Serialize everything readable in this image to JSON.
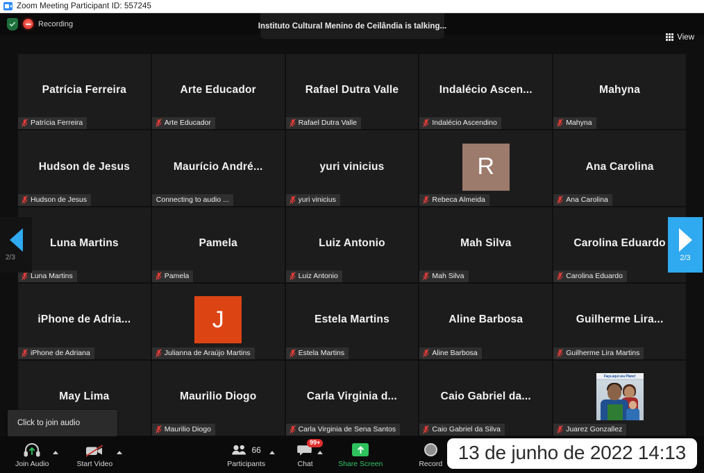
{
  "titlebar": {
    "icon": "zoom-app-icon",
    "title": "Zoom Meeting Participant ID: 557245"
  },
  "topbar": {
    "shield_icon": "encryption-shield-icon",
    "recording_icon": "recording-indicator-icon",
    "recording_label": "Recording",
    "talking_status": "Instituto Cultural Menino de Ceilândia is talking...",
    "view_icon": "grid-view-icon",
    "view_label": "View"
  },
  "gallery": {
    "page_indicator": "2/3",
    "prev_icon": "chevron-left-icon",
    "next_icon": "chevron-right-icon",
    "mic_icon": "microphone-muted-icon",
    "tiles": [
      {
        "display_name": "Patrícia Ferreira",
        "footer": "Patrícia Ferreira",
        "muted": true,
        "avatar": null
      },
      {
        "display_name": "Arte Educador",
        "footer": "Arte Educador",
        "muted": true,
        "avatar": null
      },
      {
        "display_name": "Rafael Dutra Valle",
        "footer": "Rafael Dutra Valle",
        "muted": true,
        "avatar": null
      },
      {
        "display_name": "Indalécio  Ascen...",
        "footer": "Indalécio Ascendino",
        "muted": true,
        "avatar": null
      },
      {
        "display_name": "Mahyna",
        "footer": "Mahyna",
        "muted": true,
        "avatar": null
      },
      {
        "display_name": "Hudson de Jesus",
        "footer": "Hudson de Jesus",
        "muted": true,
        "avatar": null
      },
      {
        "display_name": "Maurício  André...",
        "footer": "Connecting to audio ...",
        "muted": false,
        "avatar": null
      },
      {
        "display_name": "yuri vinicius",
        "footer": "yuri vinicius",
        "muted": true,
        "avatar": null
      },
      {
        "display_name": "",
        "footer": "Rebeca Almeida",
        "muted": true,
        "avatar": {
          "type": "initial",
          "letter": "R",
          "color": "#9c7a6c"
        }
      },
      {
        "display_name": "Ana Carolina",
        "footer": "Ana Carolina",
        "muted": true,
        "avatar": null
      },
      {
        "display_name": "Luna Martins",
        "footer": "Luna Martins",
        "muted": true,
        "avatar": null
      },
      {
        "display_name": "Pamela",
        "footer": "Pamela",
        "muted": true,
        "avatar": null
      },
      {
        "display_name": "Luiz Antonio",
        "footer": "Luiz Antonio",
        "muted": true,
        "avatar": null
      },
      {
        "display_name": "Mah Silva",
        "footer": "Mah Silva",
        "muted": true,
        "avatar": null
      },
      {
        "display_name": "Carolina Eduardo",
        "footer": "Carolina Eduardo",
        "muted": true,
        "avatar": null
      },
      {
        "display_name": "iPhone de Adria...",
        "footer": "iPhone de Adriana",
        "muted": true,
        "avatar": null
      },
      {
        "display_name": "",
        "footer": "Julianna de Araújo Martins",
        "muted": true,
        "avatar": {
          "type": "initial",
          "letter": "J",
          "color": "#dd4414"
        }
      },
      {
        "display_name": "Estela Martins",
        "footer": "Estela Martins",
        "muted": true,
        "avatar": null
      },
      {
        "display_name": "Aline Barbosa",
        "footer": "Aline Barbosa",
        "muted": true,
        "avatar": null
      },
      {
        "display_name": "Guilherme  Lira...",
        "footer": "Guilherme Lira Martins",
        "muted": true,
        "avatar": null
      },
      {
        "display_name": "May Lima",
        "footer": "",
        "muted": false,
        "avatar": null
      },
      {
        "display_name": "Maurilio Diogo",
        "footer": "Maurilio Diogo",
        "muted": true,
        "avatar": null
      },
      {
        "display_name": "Carla Virginia d...",
        "footer": "Carla Virginia de Sena Santos",
        "muted": true,
        "avatar": null
      },
      {
        "display_name": "Caio  Gabriel da...",
        "footer": "Caio Gabriel da Silva",
        "muted": true,
        "avatar": null
      },
      {
        "display_name": "",
        "footer": "Juarez Gonzallez",
        "muted": true,
        "avatar": {
          "type": "photo",
          "caption": "Faça aqui seu Plano!"
        }
      }
    ]
  },
  "tooltip": {
    "text": "Click to join audio"
  },
  "bottombar": {
    "join_audio": {
      "label": "Join Audio",
      "icon": "headset-icon"
    },
    "start_video": {
      "label": "Start Video",
      "icon": "camera-off-icon"
    },
    "participants": {
      "label": "Participants",
      "icon": "participants-icon",
      "count": "66"
    },
    "chat": {
      "label": "Chat",
      "icon": "chat-bubble-icon",
      "badge": "99+"
    },
    "share_screen": {
      "label": "Share Screen",
      "icon": "share-screen-icon"
    },
    "record": {
      "label": "Record",
      "icon": "record-circle-icon"
    }
  },
  "clock_overlay": {
    "text": "13 de junho de 2022 14:13"
  },
  "colors": {
    "accent_blue": "#2fa9ef",
    "recording_red": "#e8433a",
    "share_green": "#2ec25e",
    "badge_red": "#e02d2d",
    "tile_bg": "#1c1c1c"
  }
}
